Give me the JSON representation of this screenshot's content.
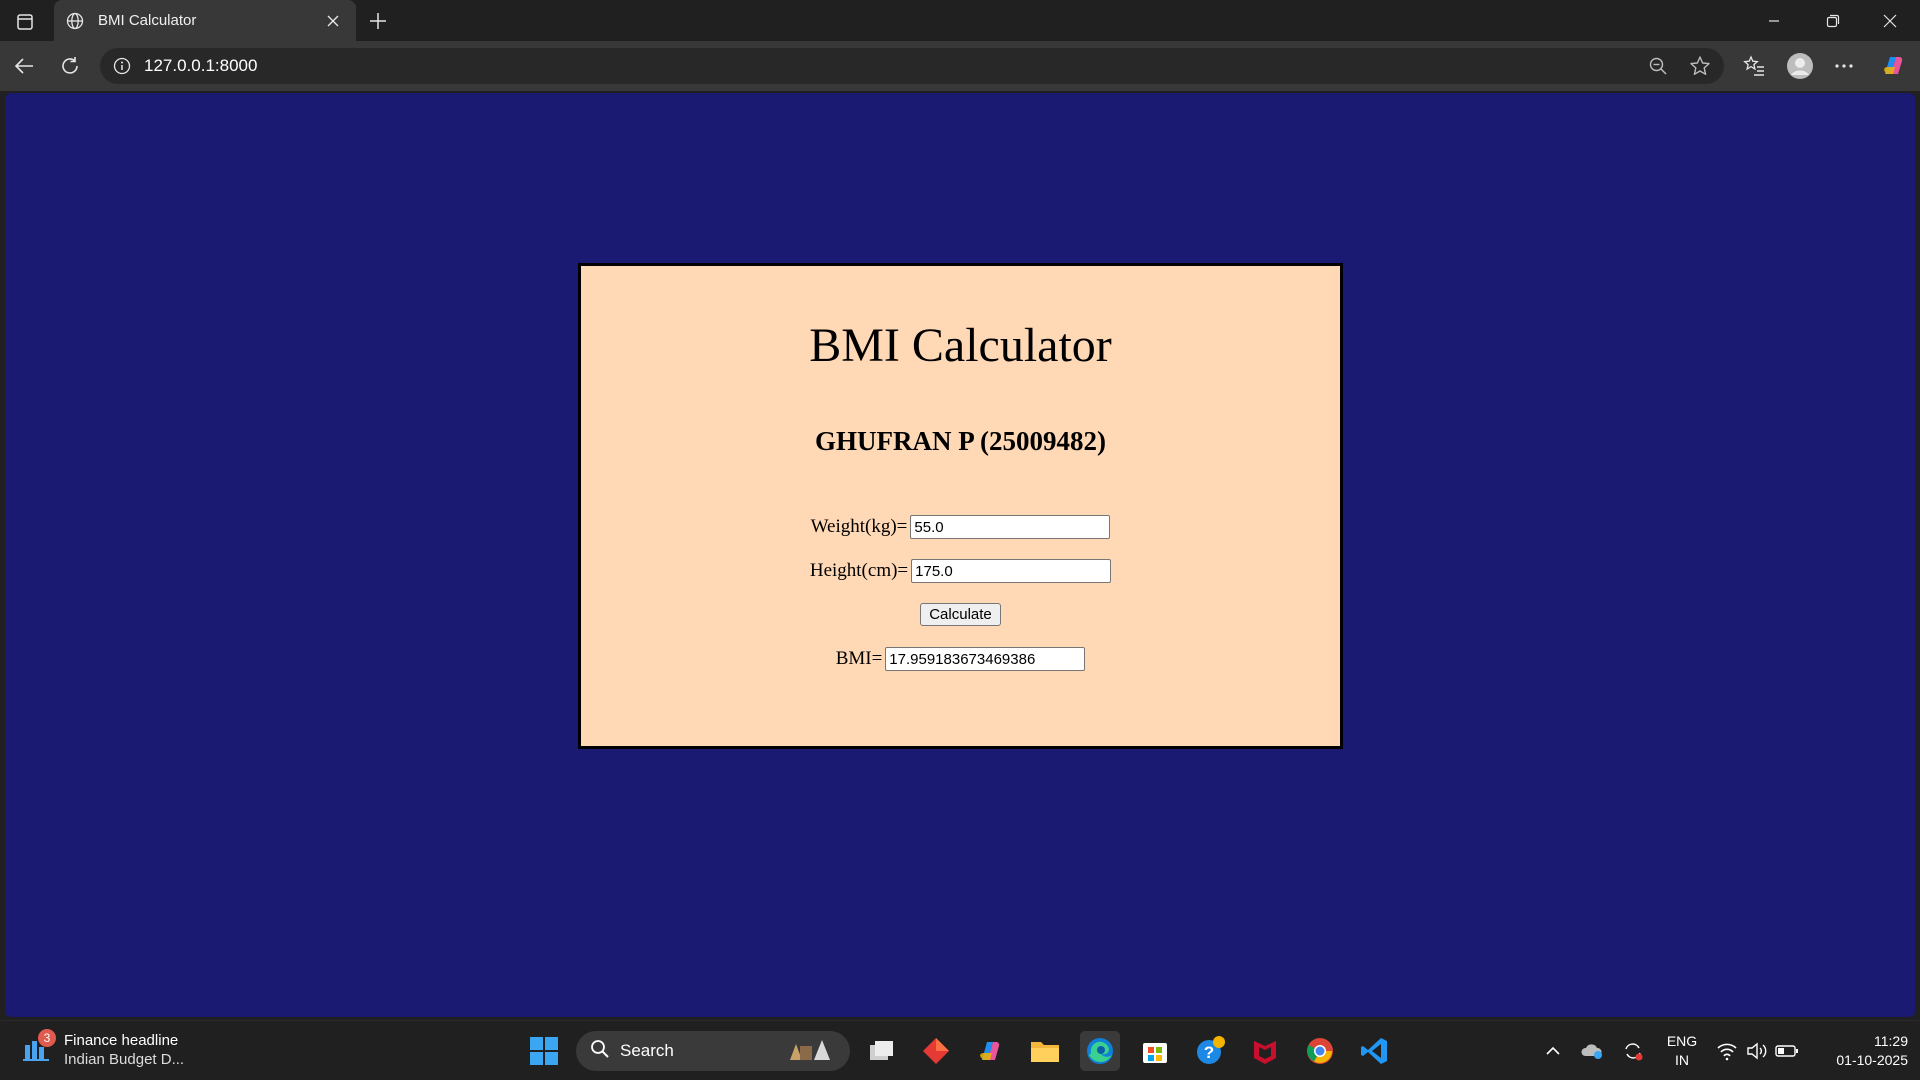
{
  "browser": {
    "tab_title": "BMI Calculator",
    "url": "127.0.0.1:8000"
  },
  "page": {
    "title": "BMI Calculator",
    "subtitle": "GHUFRAN P (25009482)",
    "weight_label": "Weight(kg)=",
    "weight_value": "55.0",
    "height_label": "Height(cm)=",
    "height_value": "175.0",
    "calculate_label": "Calculate",
    "bmi_label": "BMI=",
    "bmi_value": "17.959183673469386",
    "background_color": "#1a1a72",
    "card_color": "#ffd8b5"
  },
  "taskbar": {
    "news_badge": "3",
    "news_title": "Finance headline",
    "news_subtitle": "Indian Budget D...",
    "search_label": "Search",
    "language": "ENG",
    "region": "IN",
    "time": "11:29",
    "date": "01-10-2025"
  }
}
